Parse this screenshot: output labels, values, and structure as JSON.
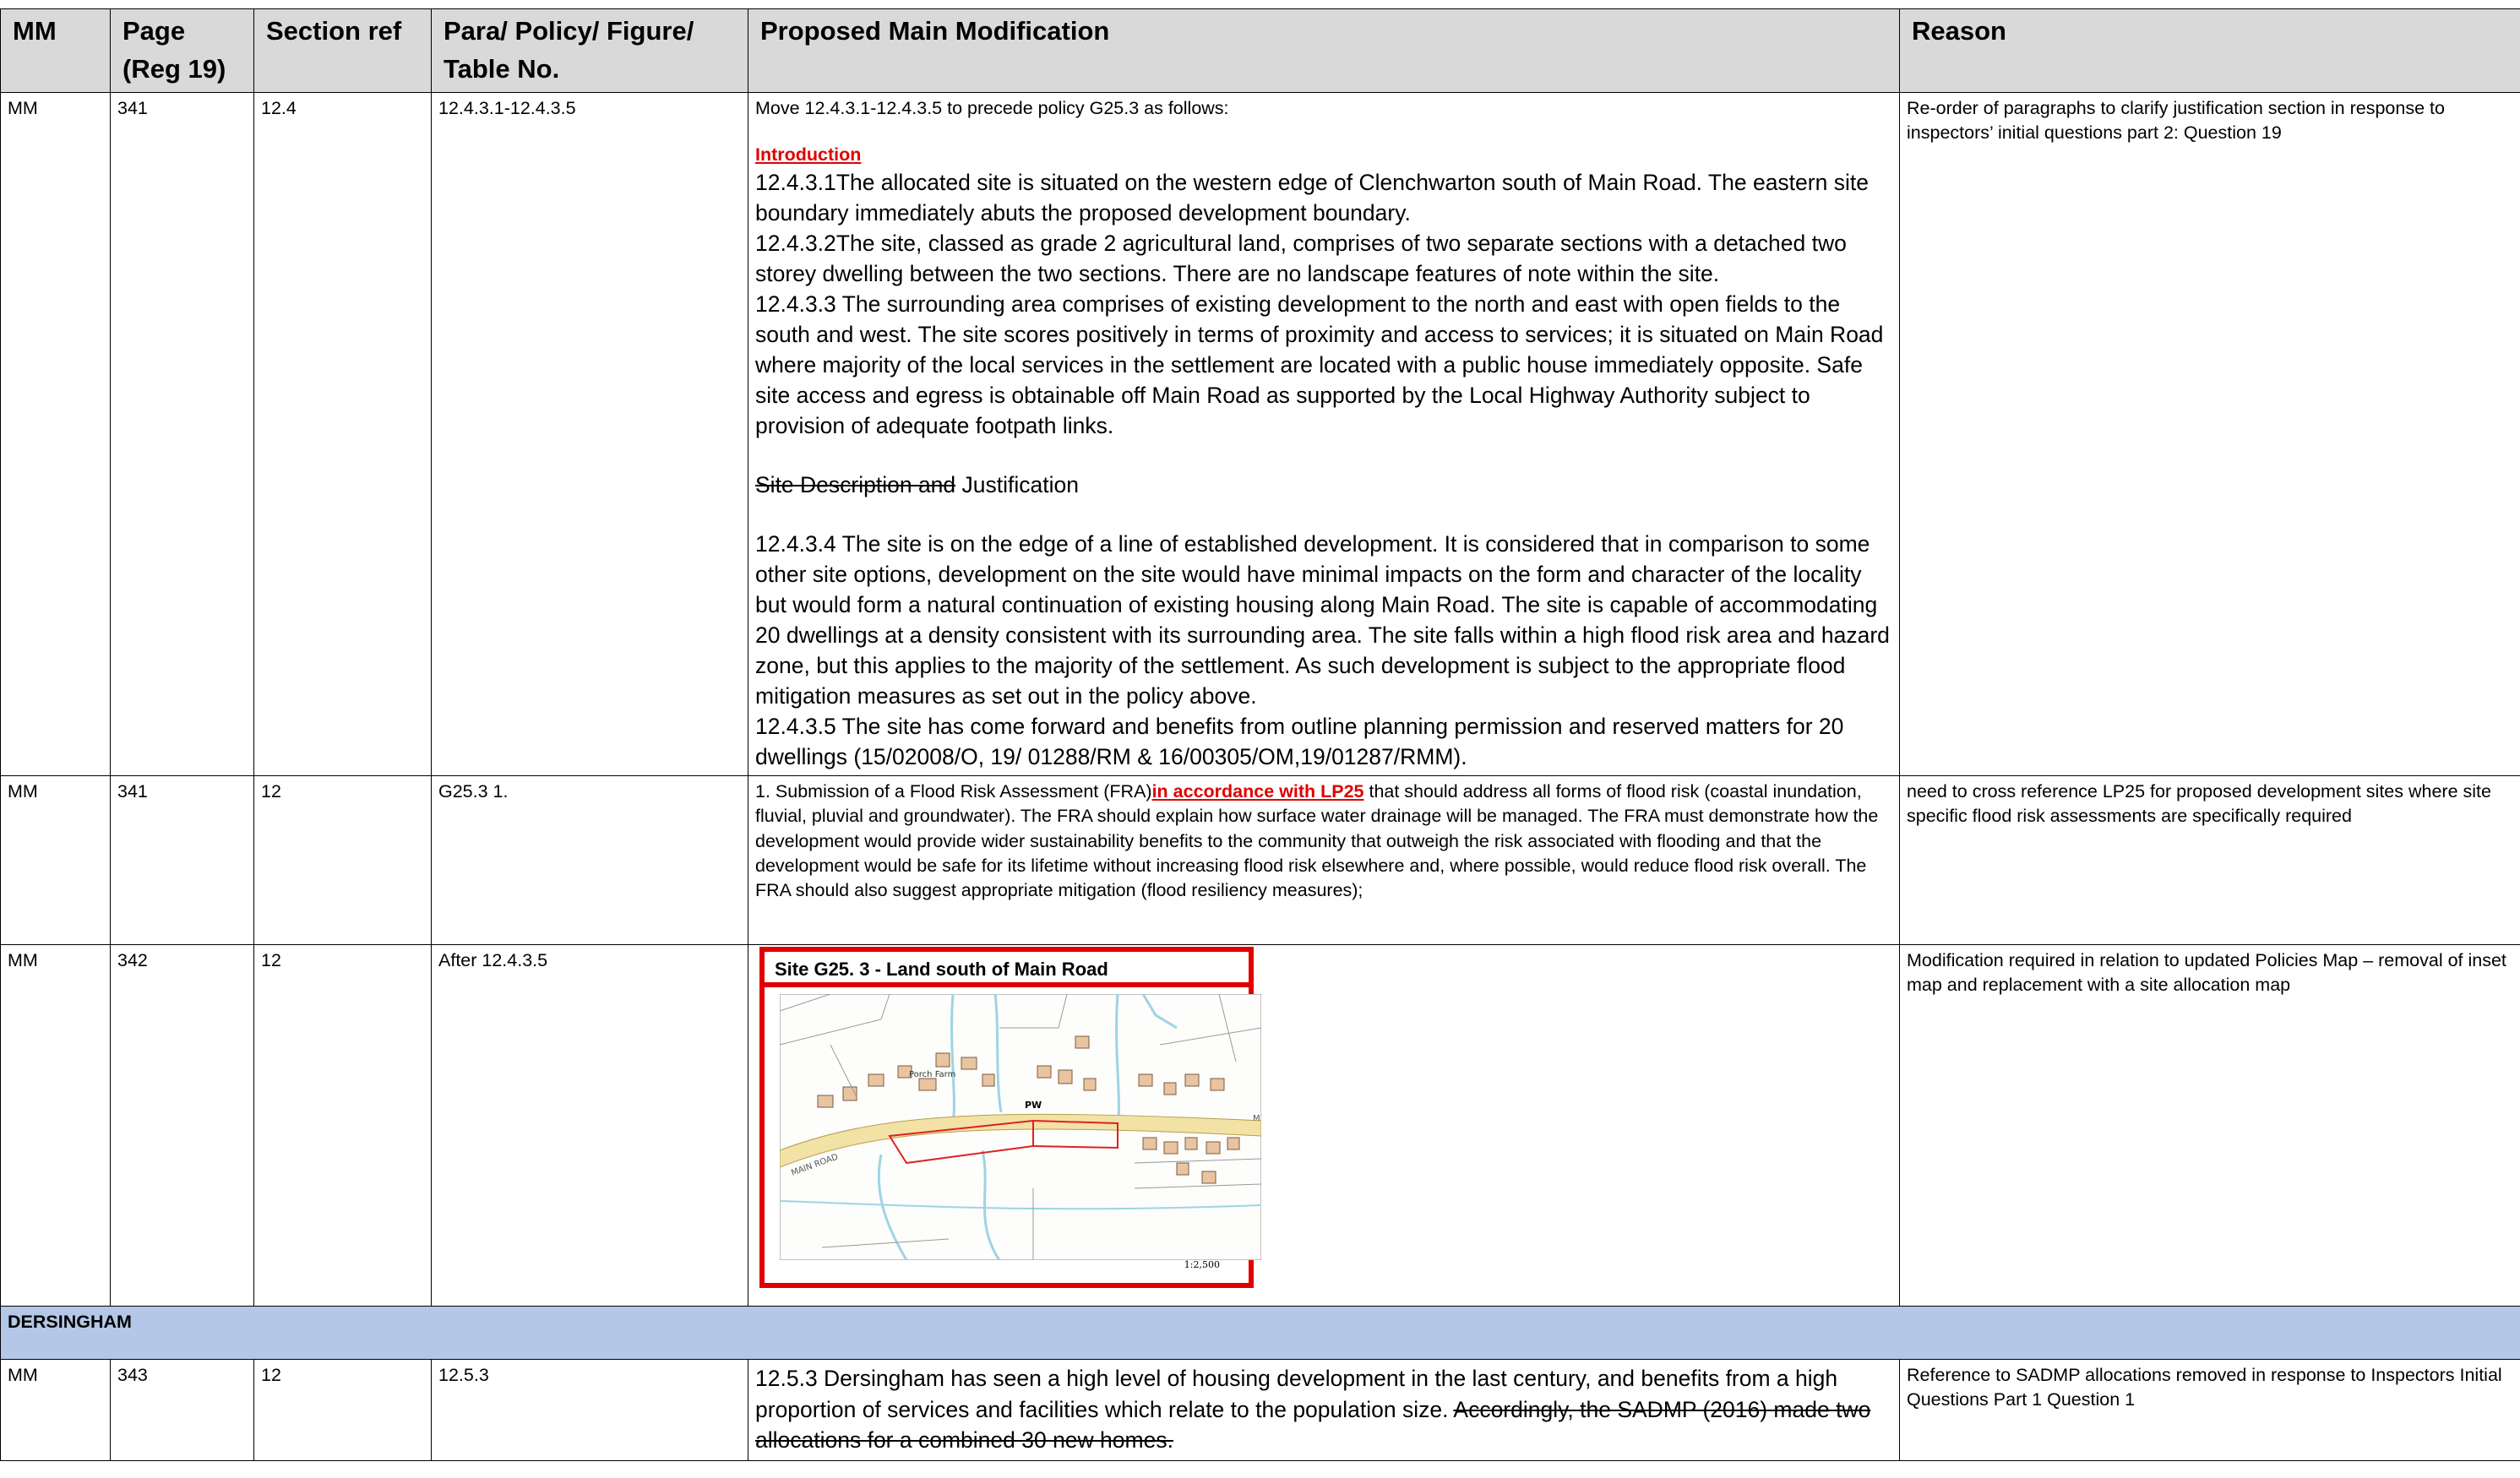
{
  "headers": {
    "mm": "MM",
    "page": "Page",
    "page_sub": "(Reg 19)",
    "section": "Section ref",
    "para": "Para/ Policy/ Figure/",
    "para_sub": "Table No.",
    "mod": "Proposed Main Modification",
    "reason": "Reason"
  },
  "row1": {
    "mm": "MM",
    "page": "341",
    "section": "12.4",
    "para": "12.4.3.1-12.4.3.5",
    "intro_line": "Move 12.4.3.1-12.4.3.5 to precede policy G25.3 as follows:",
    "intro_heading": "Introduction",
    "p1": "12.4.3.1The allocated site is situated on the western edge of Clenchwarton south of Main Road. The eastern site boundary immediately abuts the proposed development boundary.",
    "p2": "12.4.3.2The site, classed as grade 2 agricultural land, comprises of two separate sections with a detached two storey dwelling between the two sections. There are no landscape features of note within the site.",
    "p3": "12.4.3.3 The surrounding area comprises of existing development to the north and east with open fields to the south and west. The site scores positively in terms of proximity and access to services; it is situated on Main Road where majority of the local services in the settlement are located with a public house immediately opposite. Safe site access and egress is obtainable off Main Road as supported by the Local Highway Authority subject to provision of adequate footpath links.",
    "just_strike": "Site Description and",
    "just_text": " Justification",
    "p4": "12.4.3.4 The site is on the edge of a line of established development. It is considered that in comparison to some other site options, development on the site would have minimal impacts on the form and character of the locality but would form a natural continuation of existing housing along Main Road. The site is capable of accommodating 20 dwellings at a density consistent with its surrounding area. The site falls within a high flood risk area and hazard zone, but this applies to the majority of the settlement. As such development is subject to the appropriate flood mitigation measures as set out in the policy above.",
    "p5": "12.4.3.5 The site has come forward and benefits from outline planning permission and reserved matters for 20 dwellings (15/02008/O, 19/ 01288/RM & 16/00305/OM,19/01287/RMM).",
    "reason": "Re-order of paragraphs to clarify justification section in response to inspectors’ initial questions part 2: Question 19"
  },
  "row2": {
    "mm": "MM",
    "page": "341",
    "section": "12",
    "para": "G25.3 1.",
    "text_a": "1. Submission of a Flood Risk Assessment (FRA)",
    "text_red": "in accordance with LP25",
    "text_b": " that should address all forms of flood risk (coastal inundation, fluvial, pluvial and groundwater). The FRA should explain how surface water drainage will be managed. The FRA must demonstrate how the development would provide wider sustainability benefits to the community that outweigh the risk associated with flooding and that the development would be safe for its lifetime without increasing flood risk elsewhere and, where possible, would reduce flood risk overall. The FRA should also suggest appropriate mitigation (flood resiliency measures);",
    "reason": "need to cross reference LP25 for proposed development sites where site specific flood risk assessments are specifically required"
  },
  "row3": {
    "mm": "MM",
    "page": "342",
    "section": "12",
    "para": "After 12.4.3.5",
    "map_title": "Site G25. 3 - Land south of Main Road",
    "map_labels": {
      "farm": "Porch Farm",
      "pw": "PW",
      "road": "MAIN ROAD",
      "road_end": "M",
      "scale": "1:2,500"
    },
    "reason": "Modification required in relation to updated Policies Map – removal of inset map and replacement with a site allocation map"
  },
  "section_heading": "DERSINGHAM",
  "row4": {
    "mm": "MM",
    "page": "343",
    "section": "12",
    "para": "12.5.3",
    "text": "12.5.3 Dersingham has seen a high level of housing development in the last century, and benefits from a high proportion of services and facilities which relate to the population size. ",
    "strike": "Accordingly, the SADMP (2016) made two allocations for a combined 30 new homes.",
    "reason": "Reference to SADMP allocations removed in response to Inspectors Initial Questions Part 1 Question 1"
  },
  "colors": {
    "header_bg": "#d9d9d9",
    "section_bg": "#b4c7e7",
    "accent_red": "#e00000"
  }
}
